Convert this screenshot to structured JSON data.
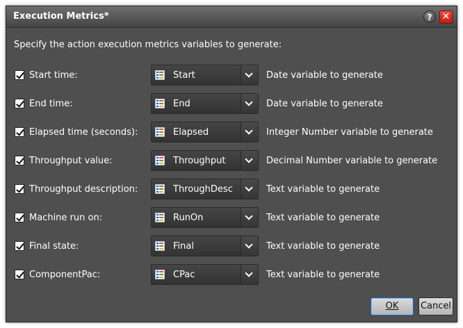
{
  "dialog": {
    "title": "Execution Metrics*",
    "help_glyph": "?",
    "close_glyph": "✕",
    "prompt": "Specify the action execution metrics variables to generate:"
  },
  "rows": [
    {
      "checked": true,
      "label": "Start time:",
      "value": "Start",
      "description": "Date variable to generate"
    },
    {
      "checked": true,
      "label": "End time:",
      "value": "End",
      "description": "Date variable to generate"
    },
    {
      "checked": true,
      "label": "Elapsed time (seconds):",
      "value": "Elapsed",
      "description": "Integer Number variable to generate"
    },
    {
      "checked": true,
      "label": "Throughput value:",
      "value": "Throughput",
      "description": "Decimal Number variable to generate"
    },
    {
      "checked": true,
      "label": "Throughput description:",
      "value": "ThroughDesc",
      "description": "Text variable to generate"
    },
    {
      "checked": true,
      "label": "Machine run on:",
      "value": "RunOn",
      "description": "Text variable to generate"
    },
    {
      "checked": true,
      "label": "Final state:",
      "value": "Final",
      "description": "Text variable to generate"
    },
    {
      "checked": true,
      "label": "ComponentPac:",
      "value": "CPac",
      "description": "Text variable to generate"
    }
  ],
  "buttons": {
    "ok_label": "OK",
    "cancel_label": "Cancel"
  },
  "icons": {
    "combo_icon": "variable-list-icon",
    "help": "help-icon",
    "close": "close-icon"
  },
  "colors": {
    "background": "#4f4f4f",
    "close": "#d92b1c",
    "ok_focus": "#1c5fb0"
  }
}
